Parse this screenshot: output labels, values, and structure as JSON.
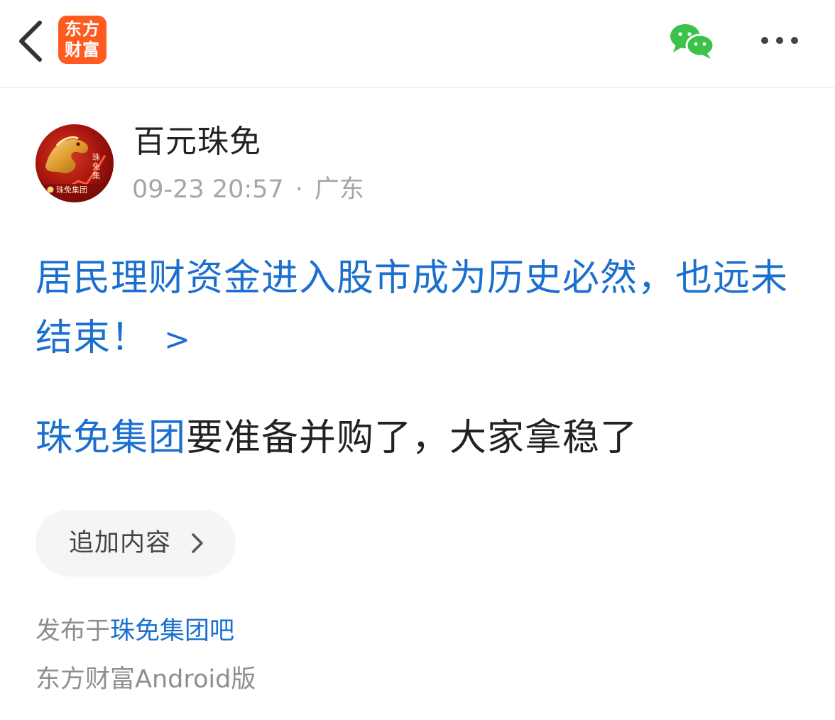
{
  "header": {
    "logo_line1": "东方",
    "logo_line2": "财富",
    "colors": {
      "logo_bg": "#ff5a1f",
      "wechat": "#3cc14a"
    },
    "icons": [
      "back-arrow-icon",
      "wechat-share-icon",
      "more-options-icon"
    ]
  },
  "author": {
    "name": "百元珠免",
    "time": "09-23 20:57",
    "separator": "·",
    "location": "广东",
    "avatar_text": "珠免集团"
  },
  "post": {
    "title": "居民理财资金进入股市成为历史必然，也远未结束！",
    "title_arrow": ">",
    "body_link": "珠免集团",
    "body_text": "要准备并购了，大家拿稳了"
  },
  "actions": {
    "append_label": "追加内容"
  },
  "footer": {
    "published_prefix": "发布于",
    "bar_name": "珠免集团吧",
    "client": "东方财富Android版"
  },
  "colors": {
    "link": "#1b6fcf",
    "text": "#222222",
    "muted": "#8e8e8e",
    "meta": "#a6a6a6"
  }
}
